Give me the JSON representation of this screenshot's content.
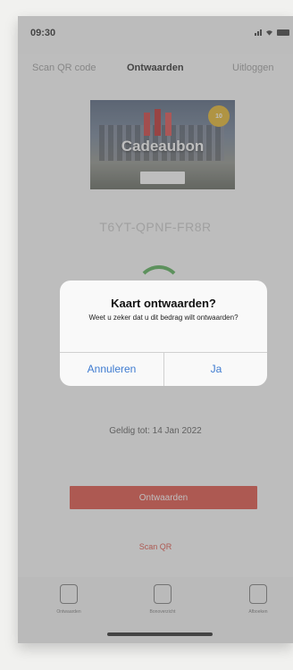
{
  "status_bar": {
    "time": "09:30"
  },
  "top_tabs": [
    {
      "label": "Scan QR code"
    },
    {
      "label": "Ontwaarden"
    },
    {
      "label": "Uitloggen"
    }
  ],
  "card": {
    "title": "Cadeaubon",
    "badge": "10"
  },
  "voucher_code": "T6YT-QPNF-FR8R",
  "valid_until": "Geldig tot: 14 Jan 2022",
  "primary_button": "Ontwaarden",
  "scan_link": "Scan QR",
  "tab_bar": [
    {
      "label": "Ontwaarden",
      "icon": "voucher-icon"
    },
    {
      "label": "Bonoverzicht",
      "icon": "receipt-icon"
    },
    {
      "label": "Afboeken",
      "icon": "archive-icon"
    }
  ],
  "dialog": {
    "title": "Kaart ontwaarden?",
    "message": "Weet u zeker dat u dit bedrag wilt ontwaarden?",
    "cancel_label": "Annuleren",
    "confirm_label": "Ja"
  },
  "colors": {
    "accent_red": "#e0473b",
    "link_blue": "#3e7bd0",
    "spinner_green": "#4fae4f"
  }
}
